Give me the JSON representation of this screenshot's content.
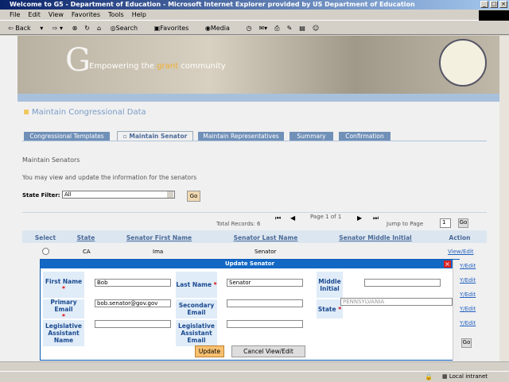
{
  "window": {
    "title": "Welcome to G5 - Department of Education - Microsoft Internet Explorer provided by US Department of Education"
  },
  "menu": [
    "File",
    "Edit",
    "View",
    "Favorites",
    "Tools",
    "Help"
  ],
  "toolbar": {
    "back": "Back",
    "search": "Search",
    "favorites": "Favorites",
    "media": "Media"
  },
  "banner": {
    "logo": "G5",
    "tagline_pre": "Empowering the ",
    "tagline_accent": "grant",
    "tagline_post": " community"
  },
  "page": {
    "title": "Maintain Congressional Data",
    "tabs": [
      "Congressional Templates",
      "Maintain Senator",
      "Maintain Representatives",
      "Summary",
      "Confirmation"
    ],
    "active_tab": 1,
    "section": "Maintain Senators",
    "intro": "You may view and update the information for the senators",
    "filter_label": "State Filter:",
    "filter_value": "All",
    "go": "Go",
    "total": "Total Records: 6",
    "page_of": "Page 1 of 1",
    "jump": "Jump to Page",
    "jump_value": "1",
    "columns": [
      "Select",
      "State",
      "Senator First Name",
      "Senator Last Name",
      "Senator Middle Initial",
      "Action"
    ],
    "rows": [
      {
        "state": "CA",
        "first": "Ima",
        "last": "Senator",
        "action": "View/Edit"
      }
    ],
    "action_partial": "Y/Edit"
  },
  "modal": {
    "title": "Update Senator",
    "first_label": "First Name",
    "first_value": "Bob",
    "last_label": "Last Name",
    "last_value": "Senator",
    "middle_label": "Middle Initial",
    "middle_value": "",
    "pemail_label": "Primary Email",
    "pemail_value": "bob.senator@gov.gov",
    "semail_label": "Secondary Email",
    "semail_value": "",
    "state_label": "State",
    "state_value": "PENNSYLVANIA",
    "laname_label": "Legislative Assistant Name",
    "laemail_label": "Legislative Assistant Email",
    "update": "Update",
    "cancel": "Cancel View/Edit",
    "required": "*"
  },
  "status": {
    "zone": "Local intranet"
  }
}
